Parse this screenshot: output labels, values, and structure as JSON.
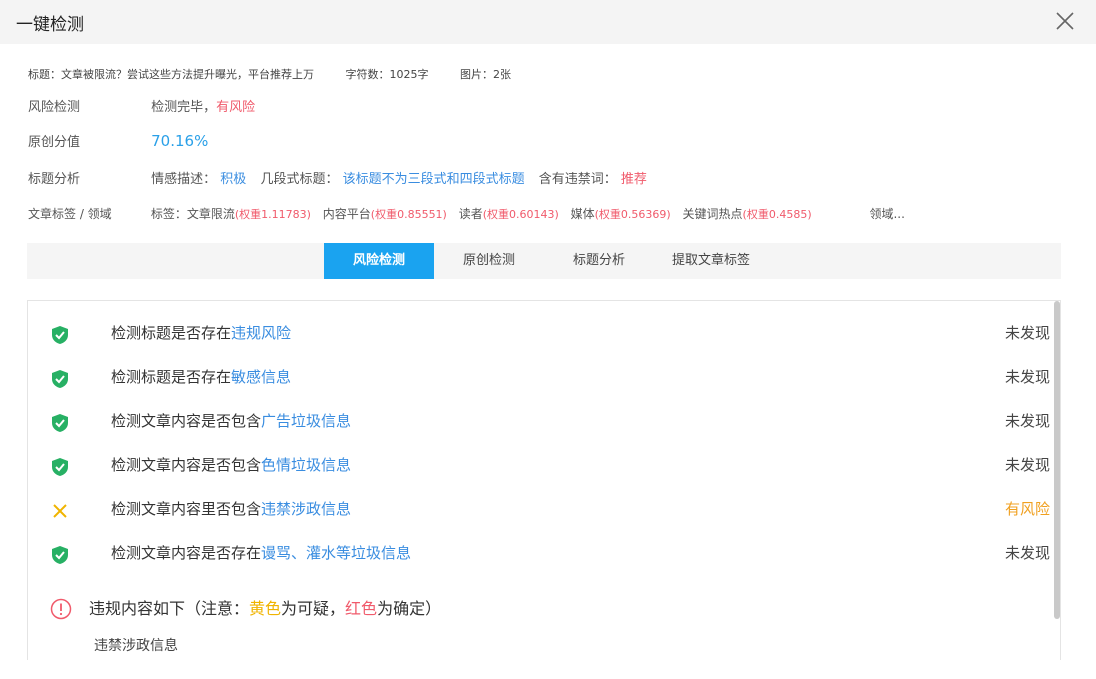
{
  "window": {
    "title": "一键检测"
  },
  "meta": {
    "title_label": "标题：文章被限流？尝试这些方法提升曝光，平台推荐上万",
    "chars": "字符数：1025字",
    "images": "图片：2张"
  },
  "rows": {
    "risk": {
      "label": "风险检测",
      "prefix": "检测完毕，",
      "value": "有风险"
    },
    "original": {
      "label": "原创分值",
      "value": "70.16%"
    },
    "title_analysis": {
      "label": "标题分析",
      "emotion_label": "情感描述：",
      "emotion_value": "积极",
      "segments_label": "几段式标题：",
      "segments_value": "该标题不为三段式和四段式标题",
      "banned_label": "含有违禁词：",
      "banned_value": "推荐"
    },
    "tags": {
      "label": "文章标签 / 领域",
      "prefix": "标签：",
      "items": [
        {
          "name": "文章限流",
          "weight": "(权重1.11783)"
        },
        {
          "name": "内容平台",
          "weight": "(权重0.85551)"
        },
        {
          "name": "读者",
          "weight": "(权重0.60143)"
        },
        {
          "name": "媒体",
          "weight": "(权重0.56369)"
        },
        {
          "name": "关键词热点",
          "weight": "(权重0.4585)"
        }
      ],
      "domain": "领域..."
    }
  },
  "tabs": [
    "风险检测",
    "原创检测",
    "标题分析",
    "提取文章标签"
  ],
  "active_tab": "风险检测",
  "checks": [
    {
      "prefix": "检测标题是否存在",
      "highlight": "违规风险",
      "result": "未发现",
      "status": "pass"
    },
    {
      "prefix": "检测标题是否存在",
      "highlight": "敏感信息",
      "result": "未发现",
      "status": "pass"
    },
    {
      "prefix": "检测文章内容是否包含",
      "highlight": "广告垃圾信息",
      "result": "未发现",
      "status": "pass"
    },
    {
      "prefix": "检测文章内容是否包含",
      "highlight": "色情垃圾信息",
      "result": "未发现",
      "status": "pass"
    },
    {
      "prefix": "检测文章内容里否包含",
      "highlight": "违禁涉政信息",
      "result": "有风险",
      "status": "risk"
    },
    {
      "prefix": "检测文章内容是否存在",
      "highlight": "谩骂、灌水等垃圾信息",
      "result": "未发现",
      "status": "pass"
    }
  ],
  "note": {
    "a": "违规内容如下（注意：",
    "yellow": "黄色",
    "b": "为可疑，",
    "red": "红色",
    "c": "为确定）",
    "item": "违禁涉政信息"
  },
  "colors": {
    "accent": "#1aa3f0",
    "pass": "#27b064",
    "risk": "#f0a020",
    "danger": "#f05a6b",
    "link": "#3a8de0"
  }
}
